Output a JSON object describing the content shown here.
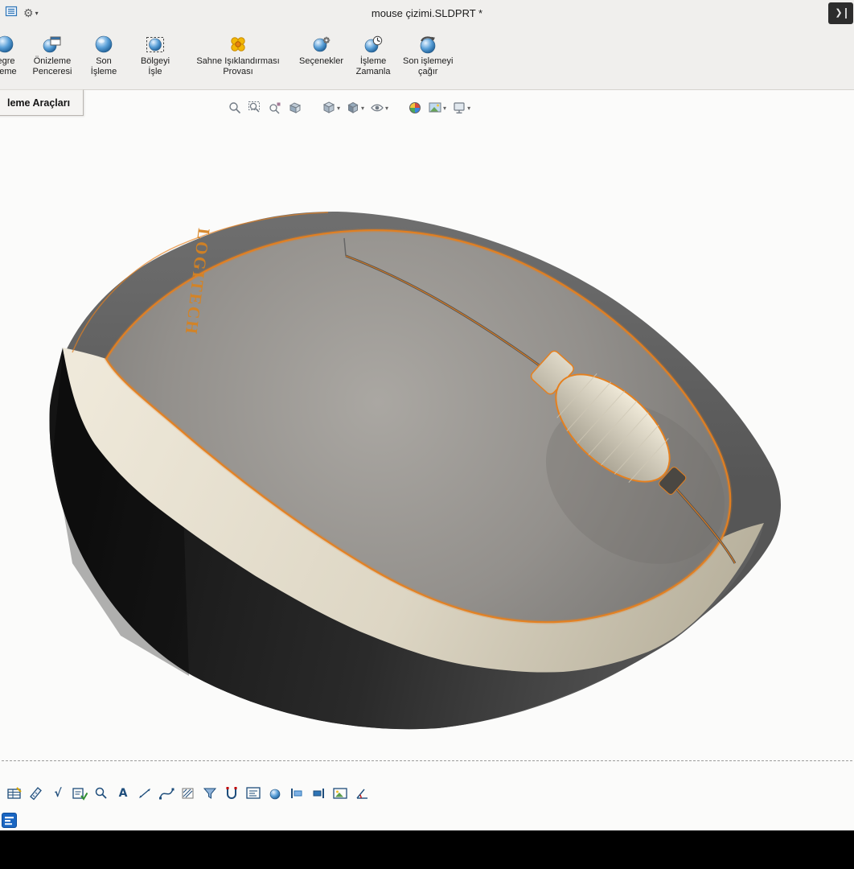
{
  "glyphs": {
    "gear": "⚙",
    "caret": "▾",
    "chevron_right": "❯",
    "sqrt": "√",
    "letter_a": "A"
  },
  "title_bar": {
    "title": "mouse çizimi.SLDPRT *"
  },
  "ribbon": {
    "tab_label": "leme Araçları",
    "items": [
      {
        "line1": "tegre",
        "line2": "zleme",
        "icon": "integrated-preview"
      },
      {
        "line1": "Önizleme",
        "line2": "Penceresi",
        "icon": "preview-window"
      },
      {
        "line1": "Son",
        "line2": "İşleme",
        "icon": "final-render"
      },
      {
        "line1": "Bölgeyi",
        "line2": "İşle",
        "icon": "render-region"
      },
      {
        "line1": "Sahne Işıklandırması",
        "line2": "Provası",
        "icon": "scene-illumination-proof"
      },
      {
        "line1": "Seçenekler",
        "line2": "",
        "icon": "options"
      },
      {
        "line1": "İşleme",
        "line2": "Zamanla",
        "icon": "schedule-render"
      },
      {
        "line1": "Son işlemeyi",
        "line2": "çağır",
        "icon": "recall-last-render"
      }
    ]
  },
  "heads_up": {
    "icons": [
      "zoom-fit",
      "zoom-area",
      "zoom-selection",
      "section-view",
      "view-orientation",
      "display-style",
      "hide-show-items",
      "edit-appearance",
      "apply-scene",
      "view-settings"
    ]
  },
  "bottom_toolbar": {
    "icons": [
      "design-table",
      "measure",
      "check-entity",
      "spell-check",
      "search",
      "note",
      "smart-dimension",
      "spline",
      "hatch-fill",
      "filter",
      "clamp",
      "text-box",
      "material-sphere",
      "align-left",
      "align-right",
      "image",
      "angle-dimension"
    ]
  },
  "viewport": {
    "model_text": "LOGITECH"
  },
  "colors": {
    "accent_orange": "#e5801f",
    "beige": "#d9d2c0",
    "ribbon_bg": "#f0efed",
    "black_bar": "#000000"
  }
}
